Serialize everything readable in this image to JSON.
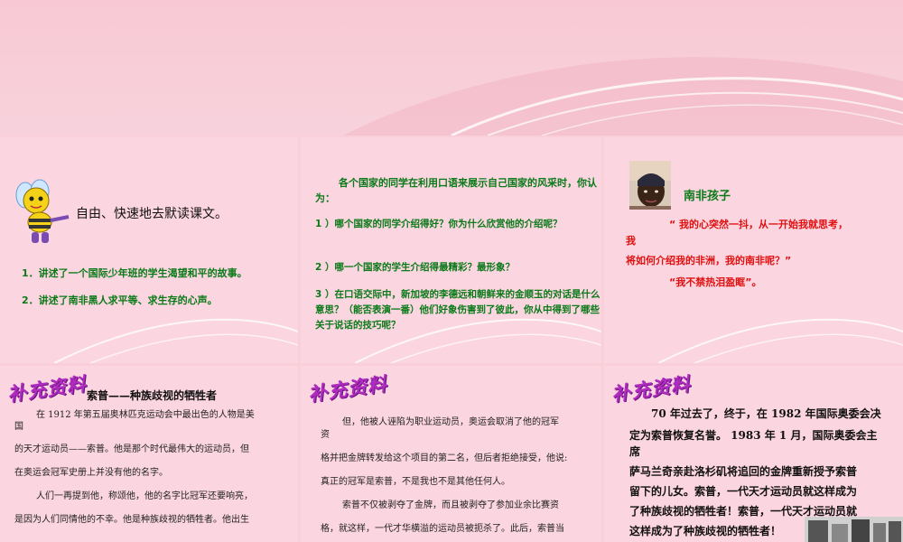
{
  "panel1": {
    "title": "自由、快速地去默读课文。",
    "items": [
      "1．讲述了一个国际少年班的学生渴望和平的故事。",
      "2．讲述了南非黑人求平等、求生存的心声。"
    ]
  },
  "panel2": {
    "intro": "各个国家的同学在利用口语来展示自己国家的风采时，你认为：",
    "q1": "1 ）哪个国家的同学介绍得好？你为什么欣赏他的介绍呢？",
    "q2": "2 ）哪一个国家的学生介绍得最精彩？最形象？",
    "q3": "3 ）在口语交际中，新加坡的李德远和朝鲜来的金顺玉的对话是什么意思？（能否表演一番）他们好象伤害到了彼此，你从中得到了哪些关于说话的技巧呢？"
  },
  "panel3": {
    "heading": "南非孩子",
    "quote1a": "“ 我的心突然一抖，从一开始我就思考，",
    "quote1b": "我",
    "quote1c": "将如何介绍我的非洲，我的南非呢？”",
    "quote2": "“我不禁热泪盈眶”。"
  },
  "supplement_label": "补充资料",
  "panel4": {
    "title": "索普——种族歧视的牺牲者",
    "lines": [
      "在 1912 年第五届奥林匹克运动会中最出色的人物是美",
      "国",
      "的天才运动员——索普。他是那个时代最伟大的运动员，但",
      "在奥运会冠军史册上并没有他的名字。",
      "人们一再提到他，称颂他，他的名字比冠军还要响亮，",
      "是因为人们同情他的不幸。他是种族歧视的牺牲者。他出生"
    ]
  },
  "panel5": {
    "lines": [
      "但，他被人诬陷为职业运动员，奥运会取消了他的冠军",
      "资",
      "格并把金牌转发给这个项目的第二名，但后者拒绝接受，他说:",
      "真正的冠军是索普，不是我也不是其他任何人。",
      "索普不仅被剥夺了金牌，而且被剥夺了参加业余比赛资",
      "格，就这样，一代才华横溢的运动员被扼杀了。此后，索普当"
    ]
  },
  "panel6": {
    "lines": [
      "70 年过去了，终于，在 1982 年国际奥委会决",
      "定为索普恢复名誉。 1983 年 1 月，国际奥委会主",
      "席",
      "萨马兰奇亲赴洛杉矶将追回的金牌重新授予索普",
      "留下的儿女。索普，一代天才运动员就这样成为",
      "了种族歧视的牺牲者！索普，一代天才运动员就",
      "这样成为了种族歧视的牺牲者！"
    ]
  }
}
